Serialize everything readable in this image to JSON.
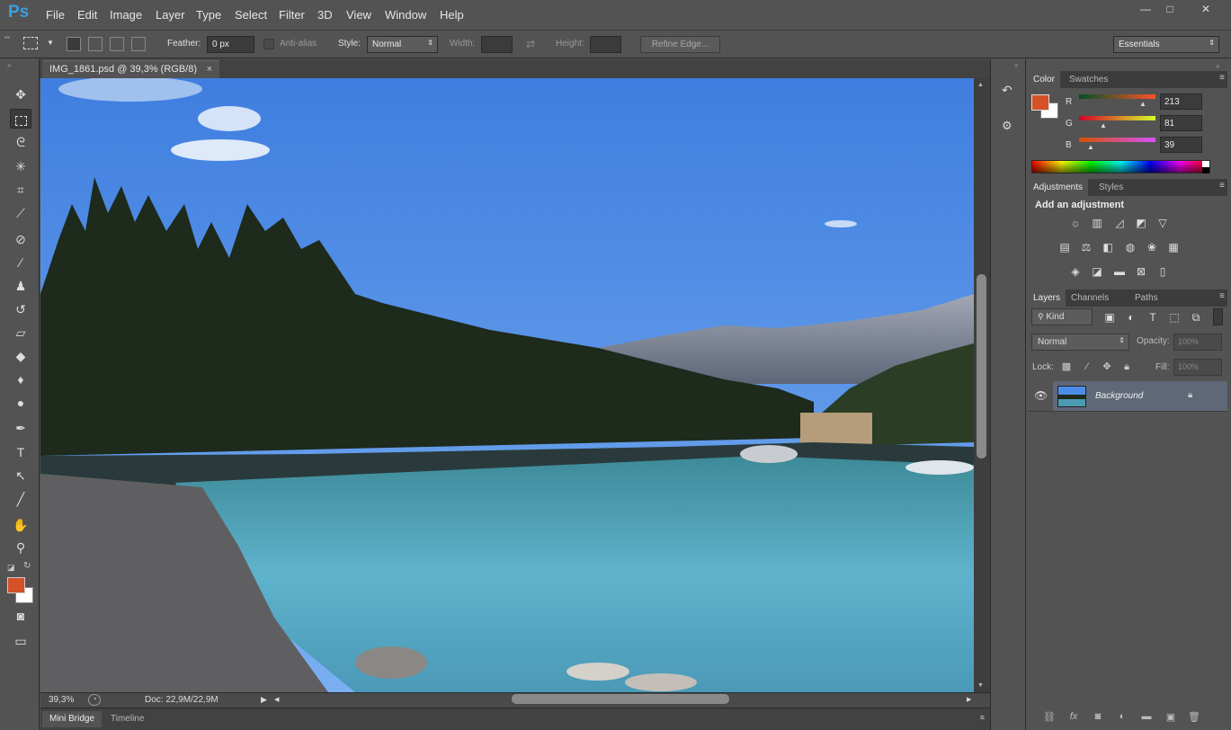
{
  "app": {
    "logo": "Ps"
  },
  "menu": [
    "File",
    "Edit",
    "Image",
    "Layer",
    "Type",
    "Select",
    "Filter",
    "3D",
    "View",
    "Window",
    "Help"
  ],
  "window_buttons": {
    "minimize": "—",
    "maximize": "□",
    "close": "✕"
  },
  "options": {
    "feather_label": "Feather:",
    "feather_value": "0 px",
    "antialias_label": "Anti-alias",
    "style_label": "Style:",
    "style_value": "Normal",
    "width_label": "Width:",
    "height_label": "Height:",
    "refine_edge": "Refine Edge...",
    "workspace": "Essentials"
  },
  "document": {
    "tab_title": "IMG_1861.psd @ 39,3% (RGB/8)",
    "close": "×",
    "zoom": "39,3%",
    "doc_size": "Doc: 22,9M/22,9M"
  },
  "bottom_tabs": [
    "Mini Bridge",
    "Timeline"
  ],
  "color_panel": {
    "tabs": [
      "Color",
      "Swatches"
    ],
    "r_label": "R",
    "g_label": "G",
    "b_label": "B",
    "r": 213,
    "g": 81,
    "b": 39,
    "r_text": "213",
    "g_text": "81",
    "b_text": "39",
    "foreground": "#d55127",
    "background": "#ffffff"
  },
  "adjustments_panel": {
    "tabs": [
      "Adjustments",
      "Styles"
    ],
    "heading": "Add an adjustment"
  },
  "layers_panel": {
    "tabs": [
      "Layers",
      "Channels",
      "Paths"
    ],
    "filter_kind": "Kind",
    "blend_mode": "Normal",
    "opacity_label": "Opacity:",
    "opacity_value": "100%",
    "lock_label": "Lock:",
    "fill_label": "Fill:",
    "fill_value": "100%",
    "layers": [
      {
        "name": "Background",
        "visible": true,
        "locked": true
      }
    ]
  }
}
